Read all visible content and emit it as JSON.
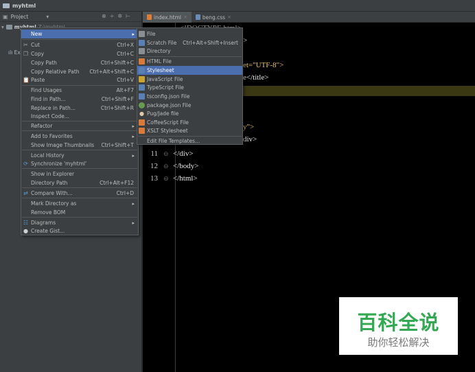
{
  "window": {
    "title": "myhtml"
  },
  "project_panel": {
    "view_label": "Project",
    "root_name": "myhtml",
    "root_path": "Z:\\myhtml",
    "child_label": "Ex"
  },
  "tabs": [
    {
      "label": "index.html"
    },
    {
      "label": "beng.css"
    }
  ],
  "editor": {
    "visible_fragments": {
      "line1": "<!DOCTYPE html>",
      "line3": ">",
      "line5_tail": "et=\"UTF-8\">",
      "line6_tail": "e</title>",
      "line9_tail": "y\">",
      "line10_tail": "div>"
    },
    "lines": [
      {
        "num": "11",
        "code": "</div>"
      },
      {
        "num": "12",
        "code": "</body>"
      },
      {
        "num": "13",
        "code": "</html>"
      }
    ]
  },
  "context_menu": {
    "items": [
      {
        "label": "New",
        "icon": "none",
        "submenu": true,
        "selected": true
      },
      {
        "label": "Cut",
        "shortcut": "Ctrl+X",
        "icon": "scissors-icon"
      },
      {
        "label": "Copy",
        "shortcut": "Ctrl+C",
        "icon": "copy-icon"
      },
      {
        "label": "Copy Path",
        "shortcut": "Ctrl+Shift+C"
      },
      {
        "label": "Copy Relative Path",
        "shortcut": "Ctrl+Alt+Shift+C"
      },
      {
        "label": "Paste",
        "shortcut": "Ctrl+V",
        "icon": "paste-icon"
      },
      {
        "label": "Find Usages",
        "shortcut": "Alt+F7"
      },
      {
        "label": "Find in Path...",
        "shortcut": "Ctrl+Shift+F"
      },
      {
        "label": "Replace in Path...",
        "shortcut": "Ctrl+Shift+R"
      },
      {
        "label": "Inspect Code..."
      },
      {
        "label": "Refactor",
        "submenu": true
      },
      {
        "label": "Add to Favorites",
        "submenu": true
      },
      {
        "label": "Show Image Thumbnails",
        "shortcut": "Ctrl+Shift+T"
      },
      {
        "label": "Local History",
        "submenu": true
      },
      {
        "label": "Synchronize 'myhtml'",
        "icon": "sync-icon"
      },
      {
        "label": "Show in Explorer"
      },
      {
        "label": "Directory Path",
        "shortcut": "Ctrl+Alt+F12"
      },
      {
        "label": "Compare With...",
        "shortcut": "Ctrl+D",
        "icon": "compare-icon"
      },
      {
        "label": "Mark Directory as",
        "submenu": true
      },
      {
        "label": "Remove BOM"
      },
      {
        "label": "Diagrams",
        "submenu": true,
        "icon": "diagram-icon"
      },
      {
        "label": "Create Gist...",
        "icon": "github-icon"
      }
    ]
  },
  "new_submenu": {
    "items": [
      {
        "label": "File",
        "icon": "file-icon"
      },
      {
        "label": "Scratch File",
        "shortcut": "Ctrl+Alt+Shift+Insert",
        "icon": "scratch-file-icon"
      },
      {
        "label": "Directory",
        "icon": "folder-icon"
      },
      {
        "label": "HTML File",
        "icon": "html-file-icon"
      },
      {
        "label": "Stylesheet",
        "icon": "stylesheet-icon",
        "selected": true
      },
      {
        "label": "JavaScript File",
        "icon": "javascript-file-icon"
      },
      {
        "label": "TypeScript File",
        "icon": "typescript-file-icon"
      },
      {
        "label": "tsconfig.json File",
        "icon": "tsconfig-icon"
      },
      {
        "label": "package.json File",
        "icon": "package-json-icon"
      },
      {
        "label": "Pug/Jade file",
        "icon": "pug-icon"
      },
      {
        "label": "CoffeeScript File",
        "icon": "coffeescript-icon"
      },
      {
        "label": "XSLT Stylesheet",
        "icon": "xslt-icon"
      },
      {
        "label": "Edit File Templates...",
        "icon": "none"
      }
    ]
  },
  "watermark": {
    "title": "百科全说",
    "subtitle": "助你轻松解决"
  },
  "colors": {
    "menu_bg": "#3c3f41",
    "selection": "#4b6eaf",
    "editor_bg": "#000000",
    "watermark_green": "#34a853"
  }
}
